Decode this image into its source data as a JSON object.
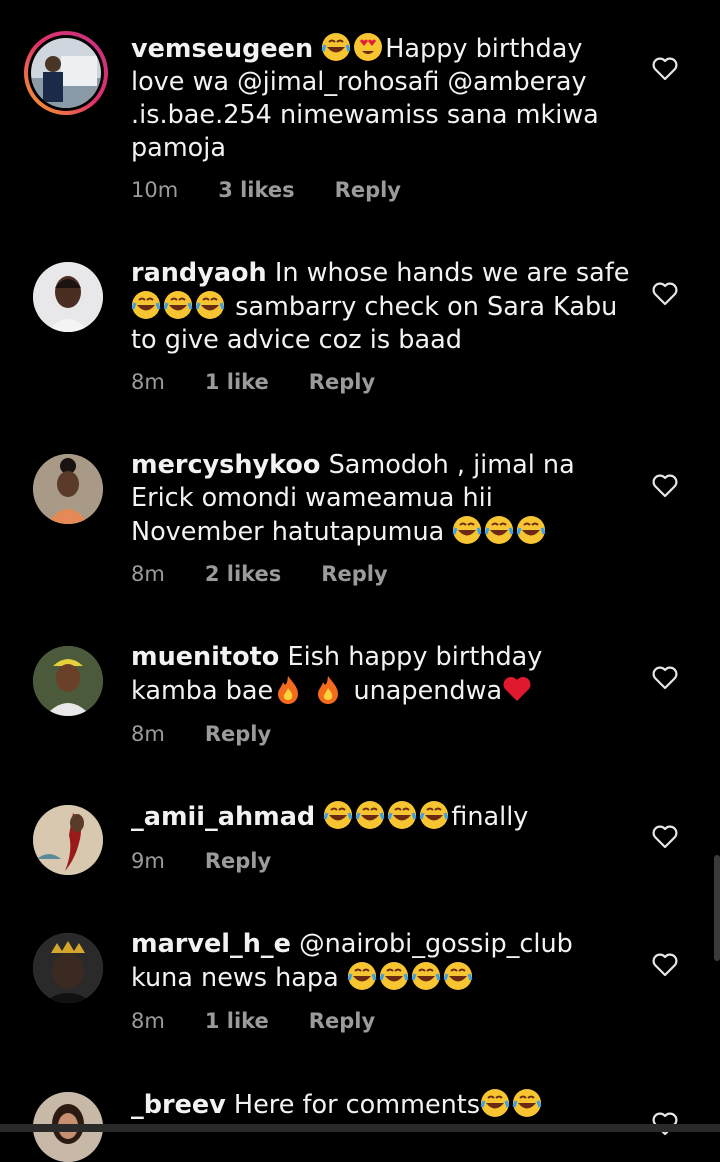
{
  "comments": [
    {
      "username": "vemseugeen",
      "text_before": "",
      "emojis_mid": [
        "laughing",
        "heart-eyes"
      ],
      "text": "Happy birthday love wa @jimal_rohosafi  @amberay .is.bae.254  nimewamiss sana mkiwa pamoja",
      "time": "10m",
      "likes": "3 likes",
      "reply": "Reply"
    },
    {
      "username": "randyaoh",
      "text": "In whose hands we are safe",
      "emojis_mid": [
        "laughing",
        "laughing",
        "laughing"
      ],
      "text_after": "sambarry check on Sara Kabu to give advice coz is baad",
      "time": "8m",
      "likes": "1 like",
      "reply": "Reply"
    },
    {
      "username": "mercyshykoo",
      "text": "Samodoh , jimal na Erick omondi wameamua hii November hatutapumua",
      "emojis_end": [
        "laughing",
        "laughing",
        "laughing"
      ],
      "time": "8m",
      "likes": "2 likes",
      "reply": "Reply"
    },
    {
      "username": "muenitoto",
      "text": "Eish happy birthday kamba bae",
      "emojis_mid": [
        "fire",
        "fire"
      ],
      "text_after": "unapendwa",
      "emojis_end": [
        "red-heart"
      ],
      "time": "8m",
      "reply": "Reply"
    },
    {
      "username": "_amii_ahmad",
      "emojis_mid": [
        "laughing",
        "laughing",
        "laughing",
        "laughing"
      ],
      "text_after": "finally",
      "time": "9m",
      "reply": "Reply"
    },
    {
      "username": "marvel_h_e",
      "text": "@nairobi_gossip_club  kuna news hapa",
      "emojis_end": [
        "laughing",
        "laughing",
        "laughing",
        "laughing"
      ],
      "time": "8m",
      "likes": "1 like",
      "reply": "Reply"
    },
    {
      "username": "_breev",
      "text": "Here for comments",
      "emojis_end": [
        "laughing",
        "laughing"
      ]
    }
  ],
  "colors": {
    "background": "#000000",
    "text": "#f2f2f2",
    "meta": "#9b9b9b"
  },
  "icons": {
    "like": "heart-outline-icon"
  }
}
